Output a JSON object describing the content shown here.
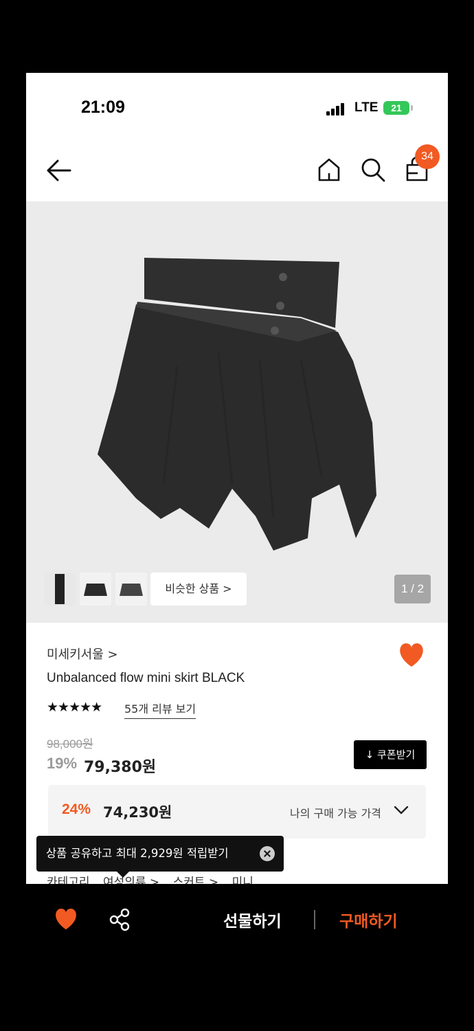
{
  "status_bar": {
    "time": "21:09",
    "network": "LTE",
    "battery": "21"
  },
  "nav": {
    "back_icon": "arrow-left-icon",
    "home_icon": "home-icon",
    "search_icon": "search-icon",
    "cart_icon": "cart-icon",
    "cart_count": "34"
  },
  "gallery": {
    "similar_label": "비슷한 상품 >",
    "page_indicator": "1 / 2",
    "current_page": 1,
    "total_pages": 2
  },
  "product": {
    "brand": "미세키서울 >",
    "name": "Unbalanced flow mini skirt BLACK",
    "stars": "★★★★★",
    "rating_stars": 5,
    "review_link": "55개 리뷰 보기",
    "original_price": "98,000원",
    "discount_rate": "19%",
    "sale_price": "79,380원",
    "coupon_label": "↓ 쿠폰받기",
    "liked": true
  },
  "my_price": {
    "rate": "24%",
    "price": "74,230원",
    "label": "나의 구매 가능 가격"
  },
  "category": {
    "label": "카테고리",
    "path": [
      "여성의류 >",
      "스커트 >",
      "미니"
    ]
  },
  "tooltip": {
    "text": "상품 공유하고 최대 2,929원 적립받기"
  },
  "bottom_bar": {
    "gift_label": "선물하기",
    "buy_label": "구매하기"
  },
  "colors": {
    "accent": "#f15a22",
    "coupon_bg": "#000000",
    "gallery_bg": "#ebebeb"
  }
}
